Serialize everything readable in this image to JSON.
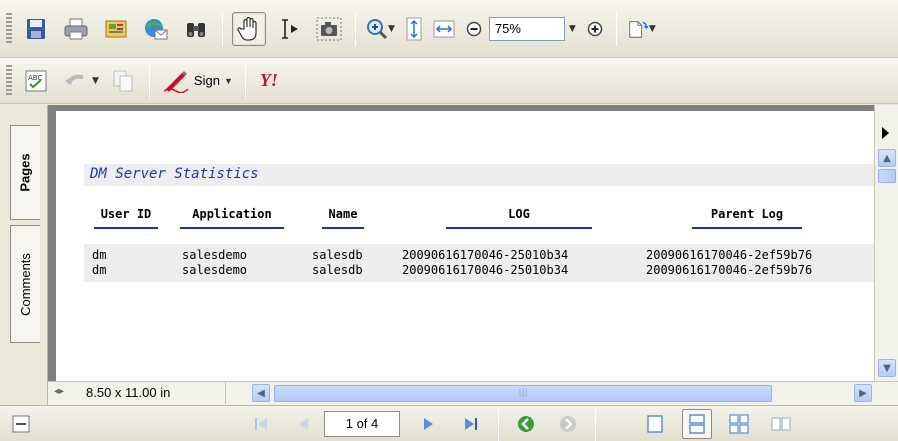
{
  "toolbar": {
    "zoom_value": "75%",
    "sign_label": "Sign",
    "yahoo_label": "Y!"
  },
  "nav_tabs": {
    "pages": "Pages",
    "comments": "Comments"
  },
  "report": {
    "title": "DM Server Statistics",
    "columns": [
      "User ID",
      "Application",
      "Name",
      "LOG",
      "Parent Log"
    ],
    "rows": [
      [
        "dm",
        "salesdemo",
        "salesdb",
        "20090616170046-25010b34",
        "20090616170046-2ef59b76"
      ],
      [
        "dm",
        "salesdemo",
        "salesdb",
        "20090616170046-25010b34",
        "20090616170046-2ef59b76"
      ]
    ]
  },
  "page_size": "8.50 x 11.00 in",
  "status": {
    "page_indicator": "1 of 4"
  },
  "colors": {
    "accent_blue": "#1F36B2",
    "band_gray": "#EDEDED",
    "scroll_blue": "#B4CCF5",
    "go_green": "#3A9B3A"
  }
}
